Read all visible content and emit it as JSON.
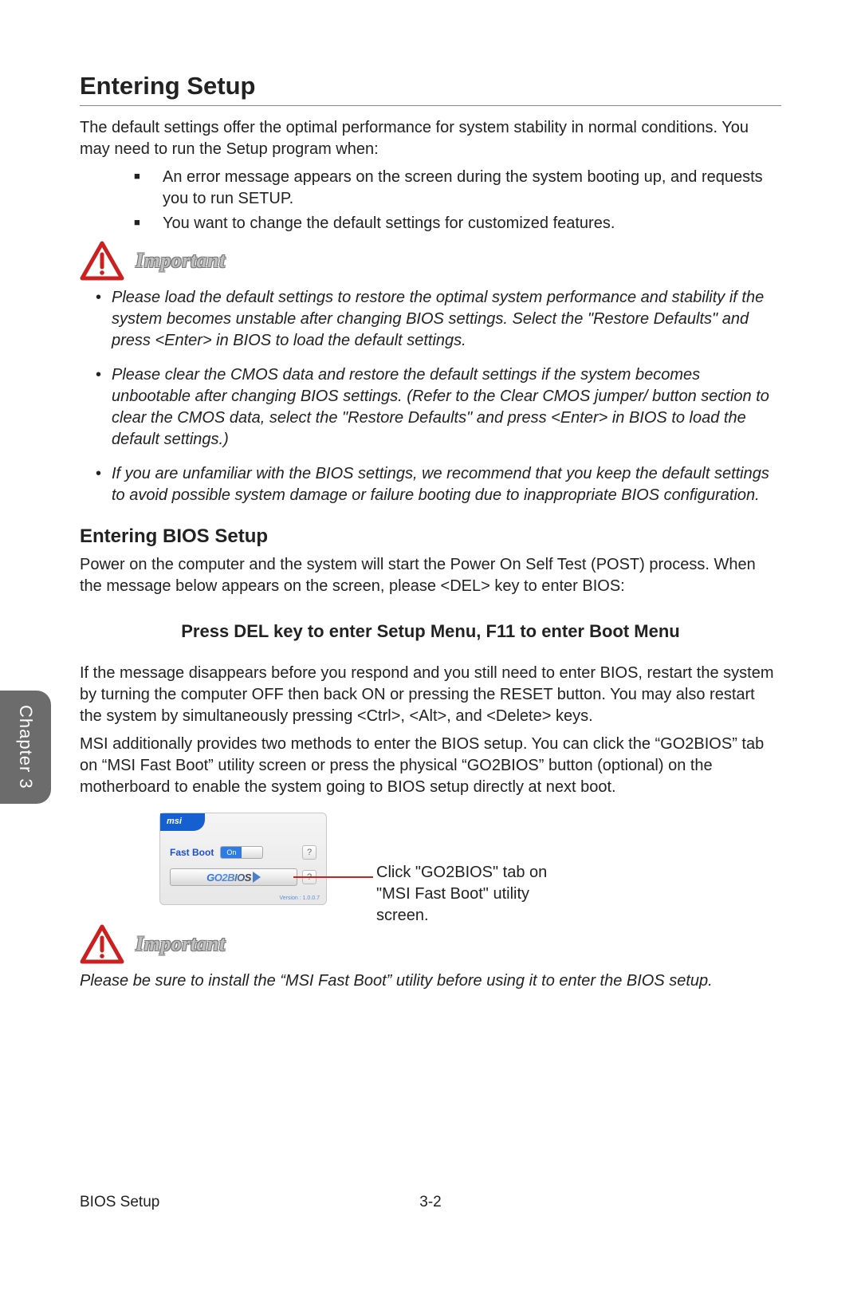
{
  "headings": {
    "main": "Entering Setup",
    "sub1": "Entering BIOS Setup",
    "centered": "Press DEL key to enter Setup Menu, F11 to enter Boot Menu"
  },
  "paragraphs": {
    "intro": "The default settings offer the optimal performance for system stability in normal conditions. You may need to run the Setup program when:",
    "power_on": "Power on the computer and the system will start the Power On Self Test (POST) process. When the message below appears on the screen, please <DEL> key to enter BIOS:",
    "if_disappears": "If the message disappears before you respond and you still need to enter BIOS, restart the system by turning the computer OFF then back ON or pressing the RESET button. You may also restart the system by simultaneously pressing <Ctrl>, <Alt>, and <Delete> keys.",
    "msi_methods": "MSI additionally provides two methods to enter the BIOS setup. You can click the “GO2BIOS” tab on “MSI Fast Boot” utility screen or press the physical “GO2BIOS” button (optional) on the motherboard to enable the system going to BIOS setup directly at next boot.",
    "important2_note": "Please be sure to install the “MSI Fast Boot” utility before using it to enter the BIOS setup."
  },
  "bullets": {
    "b1": "An error message appears on the screen during the system booting up, and requests you to run SETUP.",
    "b2": "You want to change the default settings for customized features."
  },
  "important_label": "Important",
  "notes": {
    "n1": "Please load the default settings to restore the optimal system performance and stability if the system becomes unstable after changing BIOS settings. Select the \"Restore Defaults\" and press <Enter> in BIOS to load the default settings.",
    "n2": "Please clear the CMOS data and restore the default settings if the system becomes unbootable after changing BIOS settings. (Refer to the Clear CMOS jumper/ button section to clear the CMOS data, select the \"Restore Defaults\" and press <Enter> in BIOS to load the default settings.)",
    "n3": "If you are unfamiliar with the BIOS settings, we recommend that you keep the default settings to avoid possible system damage or failure booting due to inappropriate BIOS configuration."
  },
  "figure": {
    "brand": "msi",
    "fastboot_label": "Fast Boot",
    "toggle_on": "On",
    "help": "?",
    "go2bios": "GO2BIOS",
    "version": "Version : 1.0.0.7",
    "callout": "Click \"GO2BIOS\" tab on \"MSI Fast Boot\" utility screen."
  },
  "chapter_tab": "Chapter 3",
  "footer": {
    "title": "BIOS Setup",
    "page": "3-2"
  }
}
